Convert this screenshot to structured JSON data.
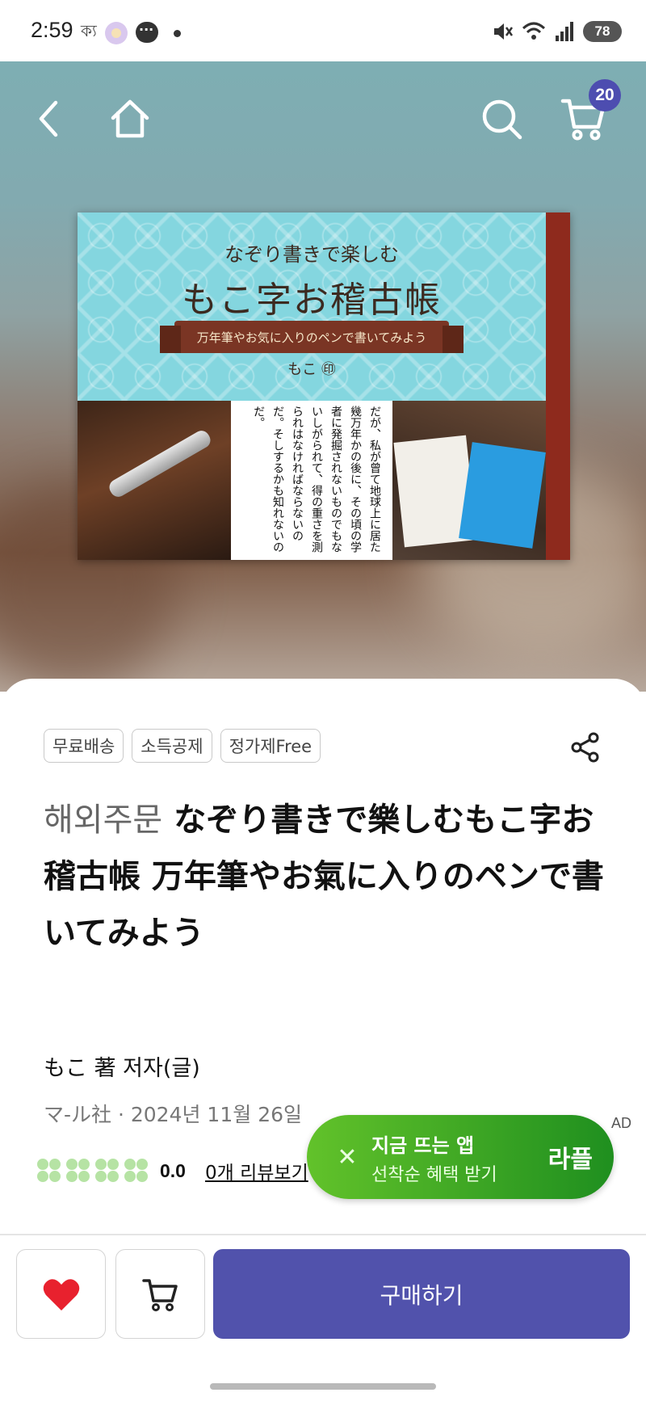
{
  "status_bar": {
    "time": "2:59",
    "notification_text": "ক্য",
    "battery": "78"
  },
  "nav": {
    "cart_count": "20"
  },
  "cover": {
    "subtitle": "なぞり書きで楽しむ",
    "title": "もこ字お稽古帳",
    "ribbon": "万年筆やお気に入りのペンで書いてみよう",
    "author": "もこ ㊞",
    "body_text": "だが、私が曾て地球上に居た幾万年かの後に、その頃の学者に発掘されないものでもないしがられて、得の重さを測られはなければならないのだ。そしするかも知れないのだ。"
  },
  "product": {
    "tags": [
      "무료배송",
      "소득공제",
      "정가제Free"
    ],
    "title_prefix": "해외주문",
    "title": "なぞり書きで樂しむもこ字お稽古帳 万年筆やお氣に入りのペンで書いてみよう",
    "author": "もこ 著 저자(글)",
    "publisher_date": "マ-ル社 · 2024년 11월 26일",
    "rating": "0.0",
    "review_link": "0개 리뷰보기",
    "rating_color": "#b6e3a4"
  },
  "ad": {
    "line1": "지금 뜨는 앱",
    "line2": "선착순 혜택 받기",
    "brand": "라플",
    "label": "AD"
  },
  "bottom_bar": {
    "buy_label": "구매하기",
    "accent_color": "#5152ac"
  }
}
